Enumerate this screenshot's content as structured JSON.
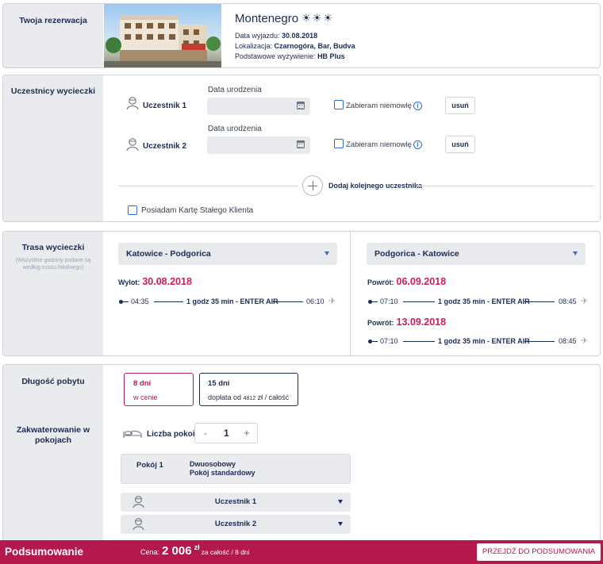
{
  "reservation": {
    "side_title": "Twoja rezerwacja",
    "hotel_name": "Montenegro",
    "departure_label": "Data wyjazdu:",
    "departure_value": "30.08.2018",
    "location_label": "Lokalizacja:",
    "location_value": "Czarnogóra, Bar, Budva",
    "board_label": "Podstawowe wyżywienie:",
    "board_value": "HB Plus"
  },
  "participants": {
    "side_title": "Uczestnicy wycieczki",
    "items": [
      {
        "name": "Uczestnik 1",
        "dob_label": "Data urodzenia",
        "dob_value": "",
        "infant_label": "Zabieram niemowlę",
        "remove_label": "usuń"
      },
      {
        "name": "Uczestnik 2",
        "dob_label": "Data urodzenia",
        "dob_value": "",
        "infant_label": "Zabieram niemowlę",
        "remove_label": "usuń"
      }
    ],
    "add_label": "Dodaj kolejnego uczestnika",
    "card_label": "Posiadam Kartę Stałego Klienta"
  },
  "route": {
    "side_title": "Trasa wycieczki",
    "side_note_1": "(Wszystkie godziny podane są",
    "side_note_2": "według czasu lokalnego)",
    "outbound": {
      "select": "Katowice - Podgorica",
      "date_label": "Wylot:",
      "date": "30.08.2018",
      "flight": {
        "dep": "04:35",
        "info": "1 godz 35 min - ENTER AIR",
        "arr": "06:10"
      }
    },
    "inbound": {
      "select": "Podgorica - Katowice",
      "options": [
        {
          "date_label": "Powrót:",
          "date": "06.09.2018",
          "flight": {
            "dep": "07:10",
            "info": "1 godz 35 min - ENTER AIR",
            "arr": "08:45"
          }
        },
        {
          "date_label": "Powrót:",
          "date": "13.09.2018",
          "flight": {
            "dep": "07:10",
            "info": "1 godz 35 min - ENTER AIR",
            "arr": "08:45"
          }
        }
      ]
    }
  },
  "stay": {
    "side_title": "Długość pobytu",
    "options": [
      {
        "title": "8 dni",
        "sub": "w cenie"
      },
      {
        "title": "15 dni",
        "sub_prefix": "dopłata od",
        "sub_amount": "4812",
        "sub_suffix": "zł / całość"
      }
    ],
    "rooms_title_1": "Zakwaterowanie w",
    "rooms_title_2": "pokojach",
    "rooms_label": "Liczba pokoi",
    "rooms_minus": "-",
    "rooms_count": "1",
    "rooms_plus": "+",
    "room": {
      "name": "Pokój 1",
      "type_1": "Dwuosobowy",
      "type_2": "Pokój standardowy"
    },
    "room_participants": [
      "Uczestnik 1",
      "Uczestnik 2"
    ]
  },
  "footer": {
    "title": "Podsumowanie",
    "price_label": "Cena:",
    "price_value": "2 006",
    "currency": "zł",
    "price_suffix": "za całość / 8 dni",
    "cta": "PRZEJDŹ DO PODSUMOWANIA"
  },
  "colors": {
    "accent": "#d11a5a",
    "footer": "#b5174f",
    "navy": "#1c2b52",
    "blue": "#2e6ad8"
  }
}
